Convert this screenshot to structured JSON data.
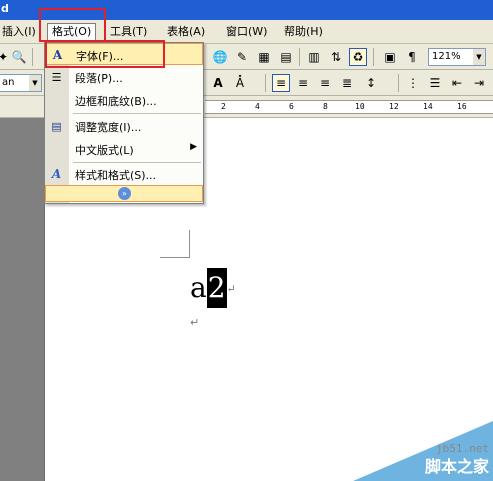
{
  "title_bar": {
    "title": "d"
  },
  "menubar": {
    "items": [
      {
        "label": "插入(I)"
      },
      {
        "label": "格式(O)"
      },
      {
        "label": "工具(T)"
      },
      {
        "label": "表格(A)"
      },
      {
        "label": "窗口(W)"
      },
      {
        "label": "帮助(H)"
      }
    ]
  },
  "toolbar": {
    "zoom": "121%",
    "font_name": "an"
  },
  "ruler": {
    "ticks": [
      "2",
      "4",
      "6",
      "8",
      "10",
      "12",
      "14",
      "16"
    ]
  },
  "format_menu": {
    "items": [
      {
        "label": "字体(F)...",
        "icon": "font-A-icon",
        "highlighted": true
      },
      {
        "label": "段落(P)...",
        "icon": "paragraph-icon"
      },
      {
        "label": "边框和底纹(B)...",
        "icon": ""
      },
      {
        "label": "调整宽度(I)...",
        "icon": "adjust-width-icon"
      },
      {
        "label": "中文版式(L)",
        "icon": "",
        "has_submenu": true
      },
      {
        "label": "样式和格式(S)...",
        "icon": "styles-A-icon"
      }
    ],
    "expand_icon": "double-chevron-down-icon"
  },
  "document": {
    "text_plain": "a",
    "text_selected": "2",
    "paragraph_mark": "↵"
  },
  "watermark": {
    "url": "jb51.net",
    "name": "脚本之家"
  },
  "colors": {
    "highlight_fill": "#ffefb0",
    "highlight_border": "#ea9b4f",
    "red_box": "#e0212c",
    "toolbar_bg": "#ebeadb"
  }
}
